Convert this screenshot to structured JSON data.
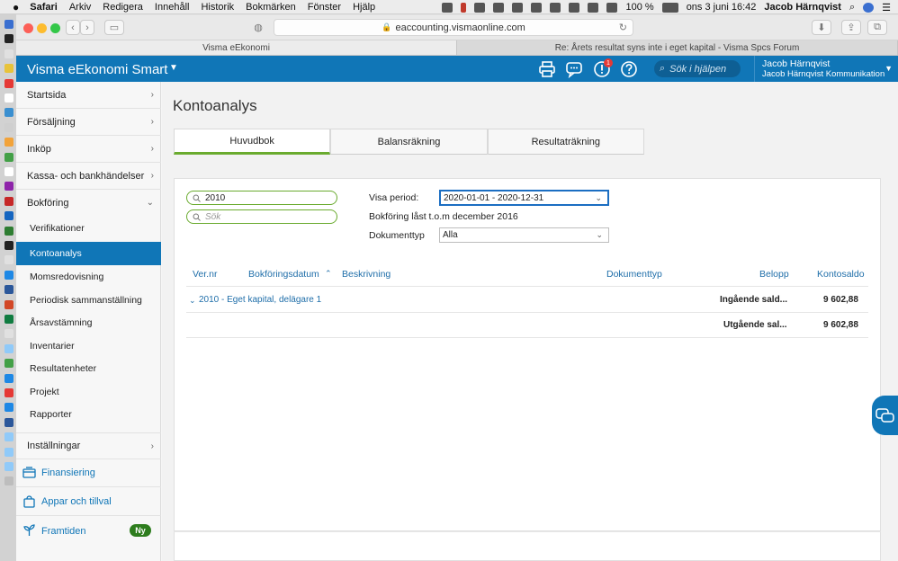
{
  "menubar": {
    "apple": "",
    "items": [
      "Safari",
      "Arkiv",
      "Redigera",
      "Innehåll",
      "Historik",
      "Bokmärken",
      "Fönster",
      "Hjälp"
    ],
    "battery": "100 %",
    "clock": "ons 3 juni  16:42",
    "user": "Jacob Härnqvist"
  },
  "browser": {
    "url": "eaccounting.vismaonline.com",
    "tabs": [
      "Visma eEkonomi",
      "Re: Årets resultat syns inte i eget kapital - Visma Spcs Forum"
    ]
  },
  "header": {
    "brand": "Visma eEkonomi Smart",
    "notification_count": "1",
    "help_search_placeholder": "Sök i hjälpen",
    "user_name": "Jacob Härnqvist",
    "company": "Jacob Härnqvist Kommunikation",
    "accent": "#1076b7"
  },
  "sidebar": {
    "items": [
      {
        "label": "Startsida"
      },
      {
        "label": "Försäljning"
      },
      {
        "label": "Inköp"
      },
      {
        "label": "Kassa- och bankhändelser"
      },
      {
        "label": "Bokföring"
      }
    ],
    "subitems": [
      {
        "label": "Verifikationer"
      },
      {
        "label": "Kontoanalys"
      },
      {
        "label": "Momsredovisning"
      },
      {
        "label": "Periodisk sammanställning"
      },
      {
        "label": "Årsavstämning"
      },
      {
        "label": "Inventarier"
      },
      {
        "label": "Resultatenheter"
      },
      {
        "label": "Projekt"
      },
      {
        "label": "Rapporter"
      }
    ],
    "settings": "Inställningar",
    "promos": [
      {
        "label": "Finansiering",
        "icon": "finance-icon"
      },
      {
        "label": "Appar och tillval",
        "icon": "shopping-bag-icon"
      },
      {
        "label": "Framtiden",
        "icon": "sprout-icon"
      }
    ],
    "badge_new": "Ny"
  },
  "main": {
    "title": "Kontoanalys",
    "tabs": [
      "Huvudbok",
      "Balansräkning",
      "Resultaträkning"
    ],
    "account_filter": "2010",
    "search_placeholder": "Sök",
    "period_label": "Visa period:",
    "period_value": "2020-01-01 - 2020-12-31",
    "locked_note": "Bokföring låst t.o.m december 2016",
    "doctype_label": "Dokumenttyp",
    "doctype_value": "Alla",
    "columns": [
      "Ver.nr",
      "Bokföringsdatum",
      "Beskrivning",
      "Dokumenttyp",
      "Belopp",
      "Kontosaldo"
    ],
    "account_row": "2010 - Eget kapital, delägare 1",
    "opening_label": "Ingående sald...",
    "opening_value": "9 602,88",
    "closing_label": "Utgående sal...",
    "closing_value": "9 602,88"
  }
}
